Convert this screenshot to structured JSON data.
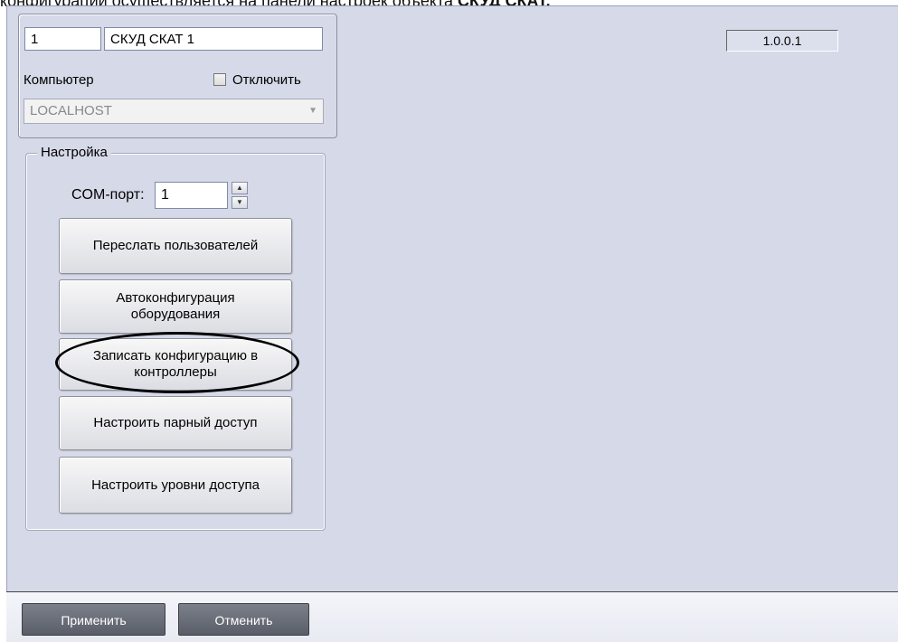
{
  "caption": {
    "text": "конфигурации осуществляется на панели настроек объекта",
    "bold": "СКУД СКАТ."
  },
  "object": {
    "id": "1",
    "name": "СКУД СКАТ 1",
    "computer_label": "Компьютер",
    "disable_label": "Отключить",
    "disable_checked": false,
    "computer_value": "LOCALHOST"
  },
  "version": "1.0.0.1",
  "settings": {
    "group_label": "Настройка",
    "com_port_label": "COM-порт:",
    "com_port_value": "1",
    "buttons": [
      "Переслать пользователей",
      "Автоконфигурация оборудования",
      "Записать конфигурацию в контроллеры",
      "Настроить парный доступ",
      "Настроить уровни доступа"
    ]
  },
  "footer": {
    "apply": "Применить",
    "cancel": "Отменить"
  },
  "icons": {
    "spin_up": "spin-up-icon",
    "spin_down": "spin-down-icon",
    "combo_arrow": "chevron-down-icon"
  }
}
